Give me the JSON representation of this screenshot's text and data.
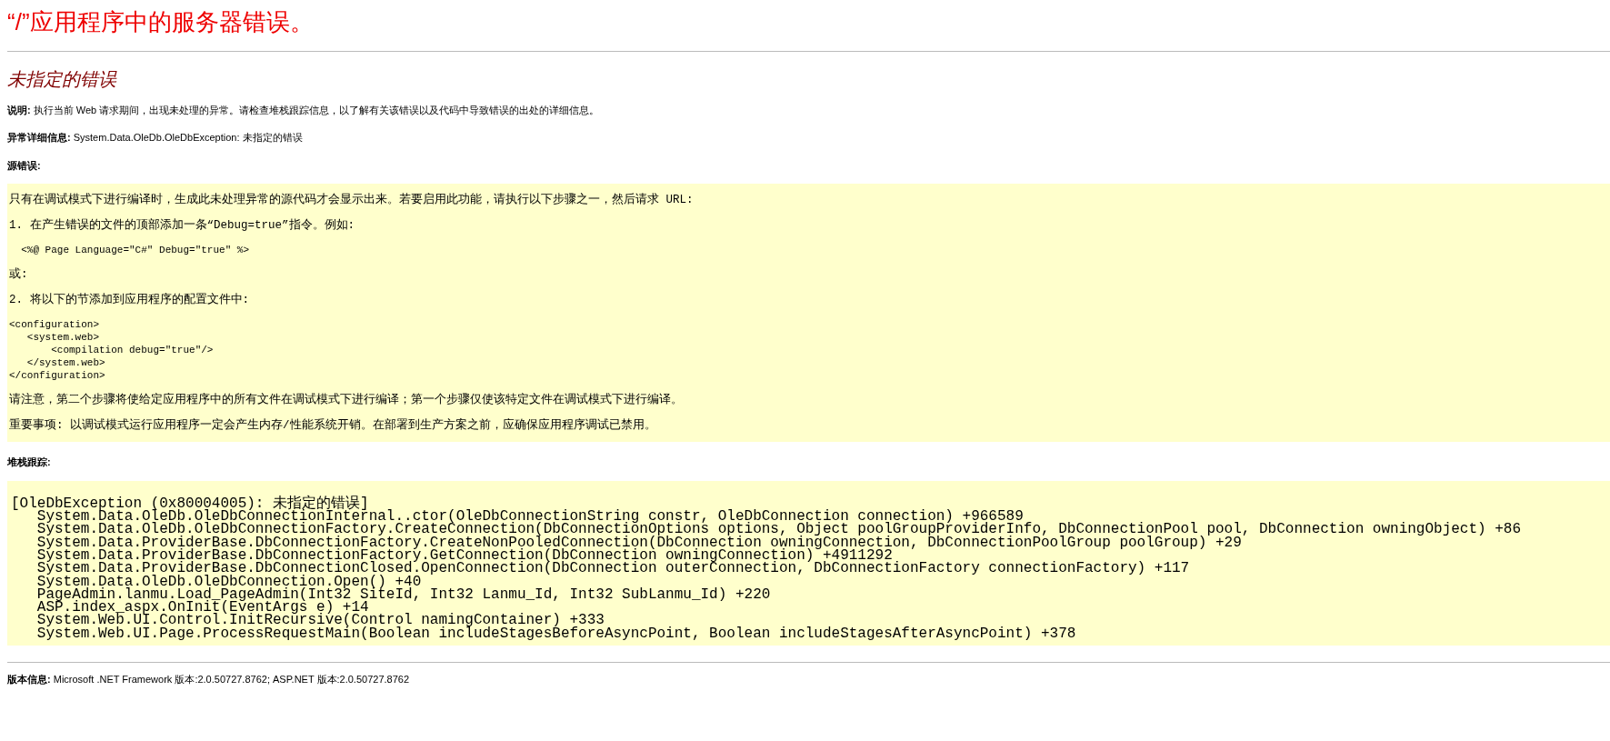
{
  "title": "“/”应用程序中的服务器错误。",
  "subtitle": "未指定的错误",
  "info": [
    {
      "text": "**说明:** 执行当前 Web 请求期间，出现未处理的异常。请检查堆栈跟踪信息，以了解有关该错误以及代码中导致错误的出处的详细信息。"
    },
    {
      "text": "**异常详细信息:** System.Data.OleDb.OleDbException: 未指定的错误"
    }
  ],
  "source_error": {
    "heading": "源错误:",
    "blocks": [
      {
        "kind": "text",
        "text": "只有在调试模式下进行编译时，生成此未处理异常的源代码才会显示出来。若要启用此功能，请执行以下步骤之一，然后请求 URL:"
      },
      {
        "kind": "text",
        "text": "1. 在产生错误的文件的顶部添加一条“Debug=true”指令。例如:"
      },
      {
        "kind": "code",
        "lines": [
          "  <%@ Page Language=\"C#\" Debug=\"true\" %>"
        ]
      },
      {
        "kind": "text",
        "text": "或:"
      },
      {
        "kind": "text",
        "text": "2. 将以下的节添加到应用程序的配置文件中:"
      },
      {
        "kind": "code",
        "lines": [
          "<configuration>",
          "   <system.web>",
          "       <compilation debug=\"true\"/>",
          "   </system.web>",
          "</configuration>"
        ]
      },
      {
        "kind": "text",
        "text": "请注意，第二个步骤将使给定应用程序中的所有文件在调试模式下进行编译；第一个步骤仅使该特定文件在调试模式下进行编译。"
      },
      {
        "kind": "text",
        "text": "重要事项: 以调试模式运行应用程序一定会产生内存/性能系统开销。在部署到生产方案之前，应确保应用程序调试已禁用。"
      }
    ]
  },
  "stack_trace": {
    "heading": "堆栈跟踪:",
    "exception": "[OleDbException (0x80004005): 未指定的错误]",
    "frames": [
      "System.Data.OleDb.OleDbConnectionInternal..ctor(OleDbConnectionString constr, OleDbConnection connection) +966589",
      "System.Data.OleDb.OleDbConnectionFactory.CreateConnection(DbConnectionOptions options, Object poolGroupProviderInfo, DbConnectionPool pool, DbConnection owningObject) +86",
      "System.Data.ProviderBase.DbConnectionFactory.CreateNonPooledConnection(DbConnection owningConnection, DbConnectionPoolGroup poolGroup) +29",
      "System.Data.ProviderBase.DbConnectionFactory.GetConnection(DbConnection owningConnection) +4911292",
      "System.Data.ProviderBase.DbConnectionClosed.OpenConnection(DbConnection outerConnection, DbConnectionFactory connectionFactory) +117",
      "System.Data.OleDb.OleDbConnection.Open() +40",
      "PageAdmin.lanmu.Load_PageAdmin(Int32 SiteId, Int32 Lanmu_Id, Int32 SubLanmu_Id) +220",
      "ASP.index_aspx.OnInit(EventArgs e) +14",
      "System.Web.UI.Control.InitRecursive(Control namingContainer) +333",
      "System.Web.UI.Page.ProcessRequestMain(Boolean includeStagesBeforeAsyncPoint, Boolean includeStagesAfterAsyncPoint) +378"
    ]
  },
  "version": "**版本信息:** Microsoft .NET Framework 版本:2.0.50727.8762; ASP.NET 版本:2.0.50727.8762"
}
